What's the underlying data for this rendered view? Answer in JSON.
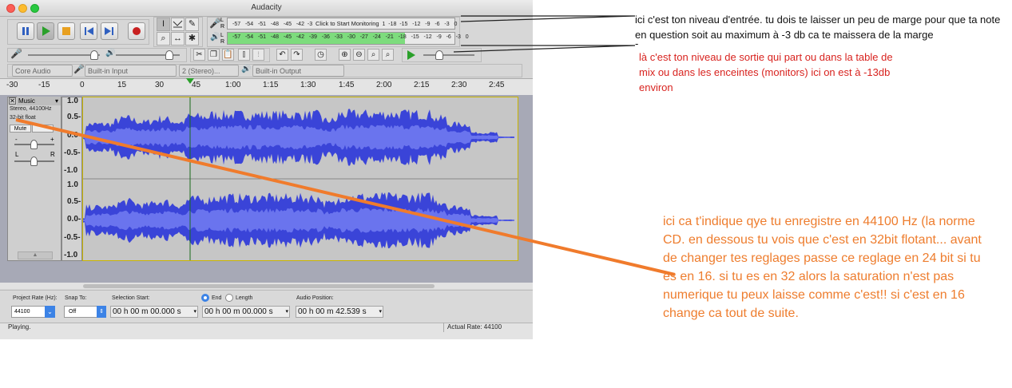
{
  "window": {
    "title": "Audacity"
  },
  "meters": {
    "record_scale": [
      "-57",
      "-54",
      "-51",
      "-48",
      "-45",
      "-42",
      "-3",
      "Click to Start Monitoring",
      "1",
      "-18",
      "-15",
      "-12",
      "-9",
      "-6",
      "-3",
      "0"
    ],
    "play_scale": [
      "-57",
      "-54",
      "-51",
      "-48",
      "-45",
      "-42",
      "-39",
      "-36",
      "-33",
      "-30",
      "-27",
      "-24",
      "-21",
      "-18",
      "-15",
      "-12",
      "-9",
      "-6",
      "-3",
      "0"
    ],
    "rec_channels": [
      "L",
      "R"
    ],
    "play_channels": [
      "L",
      "R"
    ]
  },
  "device": {
    "host": "Core Audio",
    "input": "Built-in Input",
    "channels": "2 (Stereo)...",
    "output": "Built-in Output"
  },
  "timeline": {
    "ticks": [
      "-30",
      "-15",
      "0",
      "15",
      "30",
      "45",
      "1:00",
      "1:15",
      "1:30",
      "1:45",
      "2:00",
      "2:15",
      "2:30",
      "2:45"
    ]
  },
  "track": {
    "name": "Music",
    "format": "Stereo, 44100Hz",
    "bit_depth": "32-bit float",
    "mute": "Mute",
    "gain_minus": "-",
    "gain_plus": "+",
    "pan_left": "L",
    "pan_right": "R",
    "vruler": [
      "1.0",
      "0.5-",
      "0.0-",
      "-0.5-",
      "-1.0"
    ],
    "vruler2": [
      "1.0",
      "0.5-",
      "0.0-",
      "-0.5-",
      "-1.0"
    ]
  },
  "selection_bar": {
    "project_rate_label": "Project Rate (Hz):",
    "project_rate": "44100",
    "snap_label": "Snap To:",
    "snap": "Off",
    "sel_start_label": "Selection Start:",
    "end_label": "End",
    "length_label": "Length",
    "audio_pos_label": "Audio Position:",
    "sel_start": "00 h 00 m 00.000 s",
    "sel_end": "00 h 00 m 00.000 s",
    "audio_pos": "00 h 00 m 42.539 s"
  },
  "status": {
    "text": "Playing.",
    "rate": "Actual Rate: 44100"
  },
  "annotations": {
    "input": "ici c'est ton niveau d'entrée. tu dois te laisser un peu de marge pour que  ta note en question soit au maximum à -3 db ca te maissera de la marge",
    "input_dash": "-",
    "output": "là c'est ton niveau de sortie qui part ou dans la table de mix ou dans les enceintes (monitors) ici on est à -13db environ",
    "format": "ici ca t'indique qye tu enregistre en 44100 Hz (la norme CD. en dessous tu vois que c'est en 32bit flotant... avant de changer tes reglages passe ce reglage en 24 bit si tu es en 16. si tu es en 32 alors la saturation n'est pas numerique tu peux laisse comme c'est!! si c'est en 16 change ca tout de suite."
  },
  "colors": {
    "waveform": "#3a44d8",
    "waveform_rms": "#6a74ee",
    "track_bg": "#c6c6c6",
    "annot_output": "#d8231f",
    "annot_format": "#ee7d2e",
    "arrow": "#f07b2c",
    "meter_play": "#7ddc7d"
  }
}
